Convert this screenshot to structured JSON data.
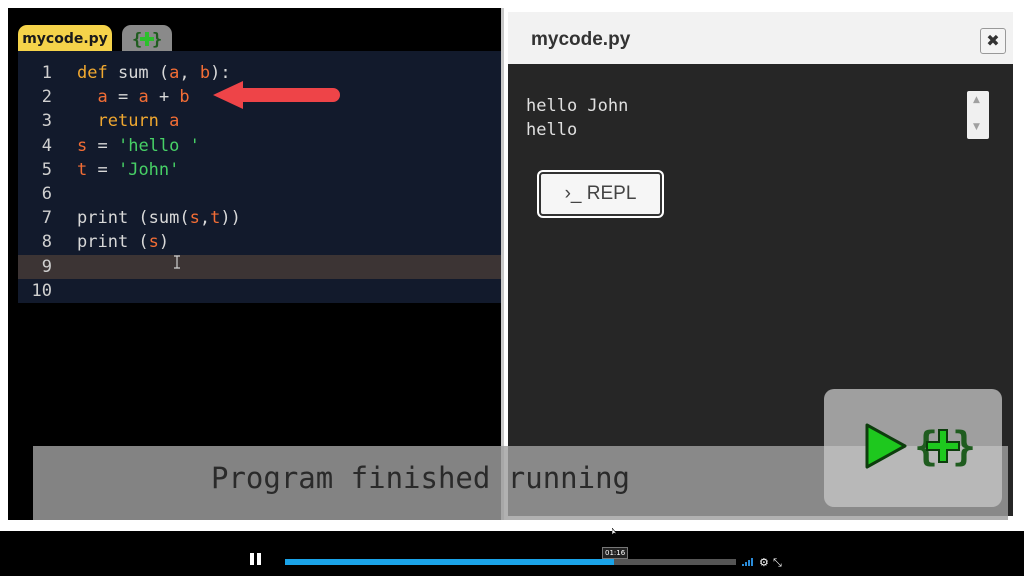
{
  "editor": {
    "tab_label": "mycode.py",
    "add_tab_icon": "plus-in-braces-icon",
    "lines": [
      {
        "n": "1",
        "tokens": [
          [
            "kw",
            "def"
          ],
          [
            "pl",
            " sum ("
          ],
          [
            "var",
            "a"
          ],
          [
            "pl",
            ", "
          ],
          [
            "var",
            "b"
          ],
          [
            "pl",
            "):"
          ]
        ]
      },
      {
        "n": "2",
        "tokens": [
          [
            "pl",
            "  "
          ],
          [
            "var",
            "a"
          ],
          [
            "pl",
            " = "
          ],
          [
            "var",
            "a"
          ],
          [
            "pl",
            " + "
          ],
          [
            "var",
            "b"
          ]
        ]
      },
      {
        "n": "3",
        "tokens": [
          [
            "pl",
            "  "
          ],
          [
            "kw",
            "return"
          ],
          [
            "pl",
            " "
          ],
          [
            "var",
            "a"
          ]
        ]
      },
      {
        "n": "4",
        "tokens": [
          [
            "var",
            "s"
          ],
          [
            "pl",
            " = "
          ],
          [
            "str",
            "'hello '"
          ]
        ]
      },
      {
        "n": "5",
        "tokens": [
          [
            "var",
            "t"
          ],
          [
            "pl",
            " = "
          ],
          [
            "str",
            "'John'"
          ]
        ]
      },
      {
        "n": "6",
        "tokens": []
      },
      {
        "n": "7",
        "tokens": [
          [
            "pl",
            "print (sum("
          ],
          [
            "var",
            "s"
          ],
          [
            "pl",
            ","
          ],
          [
            "var",
            "t"
          ],
          [
            "pl",
            "))"
          ]
        ]
      },
      {
        "n": "8",
        "tokens": [
          [
            "pl",
            "print ("
          ],
          [
            "var",
            "s"
          ],
          [
            "pl",
            ")"
          ]
        ]
      },
      {
        "n": "9",
        "tokens": []
      },
      {
        "n": "10",
        "tokens": []
      }
    ],
    "current_line": "9"
  },
  "output_panel": {
    "title": "mycode.py",
    "close_icon": "close-icon",
    "output_text": "hello John\nhello",
    "repl_label": "›_ REPL"
  },
  "overlay": {
    "message": "Program finished running",
    "play_icon": "play-icon",
    "logo_icon": "plus-in-braces-icon"
  },
  "player": {
    "time": "01:16",
    "progress": 0.73,
    "progress_color": "#1aa3e8",
    "icons": [
      "pause-icon",
      "volume-icon",
      "settings-icon",
      "fullscreen-icon"
    ]
  },
  "colors": {
    "editor_bg": "#121a2c",
    "tab_active": "#f5d34a",
    "keyword": "#f0a830",
    "variable": "#f26d35",
    "string": "#47d066",
    "play_green": "#1ec81e"
  }
}
